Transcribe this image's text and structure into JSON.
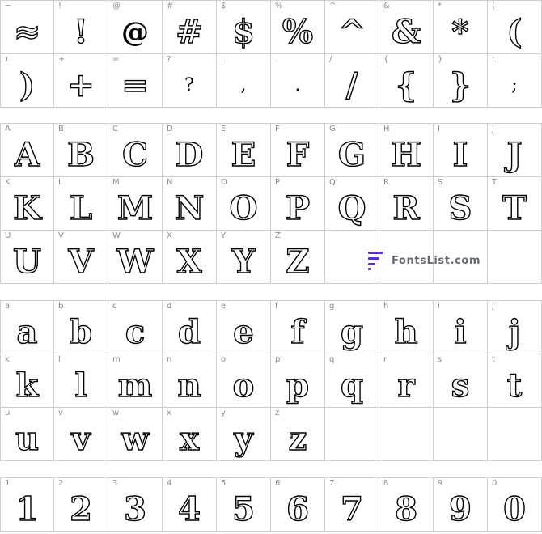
{
  "sections": [
    {
      "rows": [
        [
          "~",
          "!",
          "@",
          "#",
          "$",
          "%",
          "^",
          "&",
          "*",
          "("
        ],
        [
          ")",
          "+",
          "=",
          "?",
          ",",
          ".",
          "/",
          "{",
          "}",
          ";"
        ]
      ]
    },
    {
      "rows": [
        [
          "A",
          "B",
          "C",
          "D",
          "E",
          "F",
          "G",
          "H",
          "I",
          "J"
        ],
        [
          "K",
          "L",
          "M",
          "N",
          "O",
          "P",
          "Q",
          "R",
          "S",
          "T"
        ],
        [
          "U",
          "V",
          "W",
          "X",
          "Y",
          "Z",
          "",
          "",
          "",
          ""
        ]
      ]
    },
    {
      "rows": [
        [
          "a",
          "b",
          "c",
          "d",
          "e",
          "f",
          "g",
          "h",
          "i",
          "j"
        ],
        [
          "k",
          "l",
          "m",
          "n",
          "o",
          "p",
          "q",
          "r",
          "s",
          "t"
        ],
        [
          "u",
          "v",
          "w",
          "x",
          "y",
          "z",
          "",
          "",
          "",
          ""
        ]
      ]
    },
    {
      "rows": [
        [
          "1",
          "2",
          "3",
          "4",
          "5",
          "6",
          "7",
          "8",
          "9",
          "0"
        ]
      ]
    }
  ],
  "glyph_overrides": {
    "~": "≈"
  },
  "watermark": {
    "text": "FontsList.com",
    "logo_color": "#5b2bd6"
  }
}
